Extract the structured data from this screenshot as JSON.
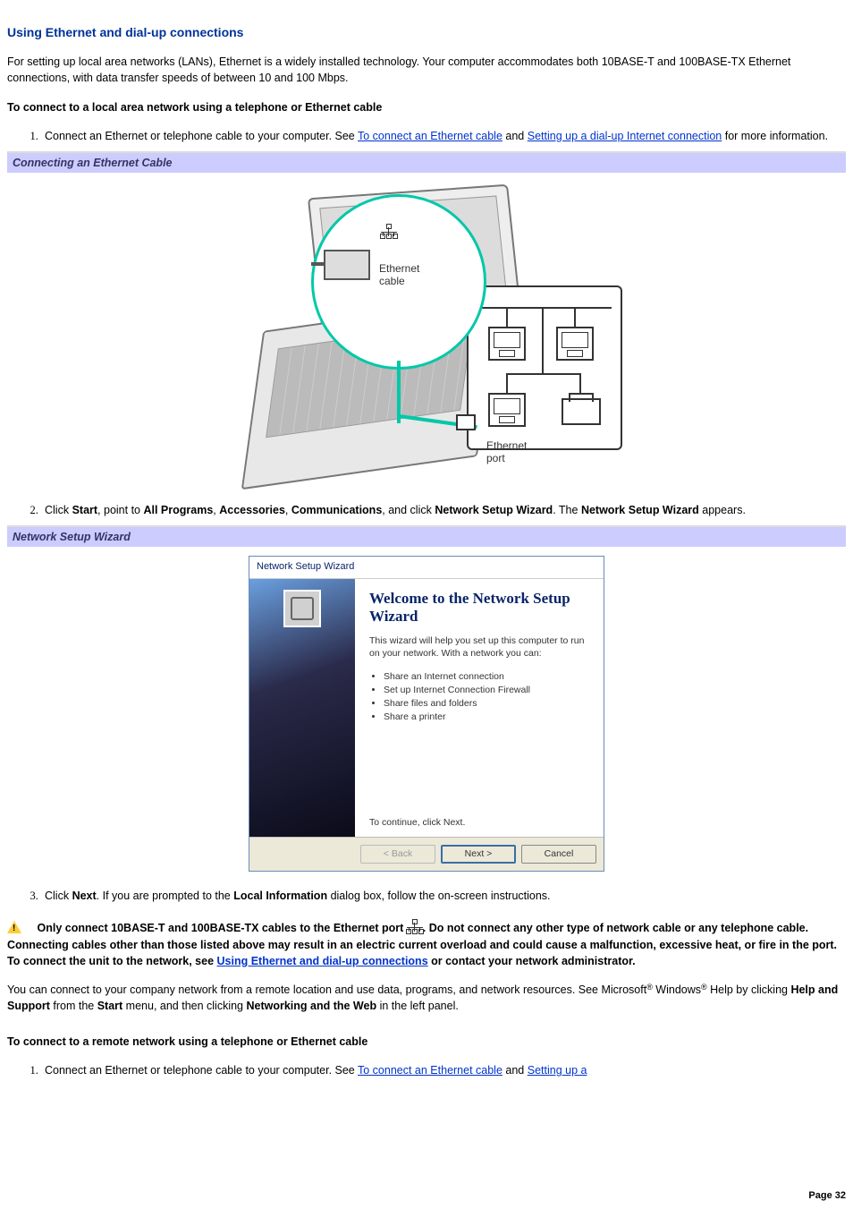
{
  "title": "Using Ethernet and dial-up connections",
  "intro": "For setting up local area networks (LANs), Ethernet is a widely installed technology. Your computer accommodates both 10BASE-T and 100BASE-TX Ethernet connections, with data transfer speeds of between 10 and 100 Mbps.",
  "proc1_heading": "To connect to a local area network using a telephone or Ethernet cable",
  "proc1": {
    "step1_pre": "Connect an Ethernet or telephone cable to your computer. See ",
    "step1_link1": "To connect an Ethernet cable",
    "step1_mid": " and ",
    "step1_link2": "Setting up a dial-up Internet connection",
    "step1_post": " for more information.",
    "band1": "Connecting an Ethernet Cable",
    "ether_label_cable": "Ethernet\ncable",
    "ether_label_port": "Ethernet\nport",
    "step2_pre": "Click ",
    "step2_b1": "Start",
    "step2_t1": ", point to ",
    "step2_b2": "All Programs",
    "step2_t2": ", ",
    "step2_b3": "Accessories",
    "step2_t3": ", ",
    "step2_b4": "Communications",
    "step2_t4": ", and click ",
    "step2_b5": "Network Setup Wizard",
    "step2_t5": ". The ",
    "step2_b6": "Network Setup Wizard",
    "step2_t6": " appears.",
    "band2": "Network Setup Wizard",
    "step3_pre": "Click ",
    "step3_b1": "Next",
    "step3_t1": ". If you are prompted to the ",
    "step3_b2": "Local Information",
    "step3_t2": " dialog box, follow the on-screen instructions."
  },
  "wizard": {
    "title": "Network Setup Wizard",
    "heading": "Welcome to the Network Setup Wizard",
    "desc": "This wizard will help you set up this computer to run on your network. With a network you can:",
    "bullets": [
      "Share an Internet connection",
      "Set up Internet Connection Firewall",
      "Share files and folders",
      "Share a printer"
    ],
    "continue": "To continue, click Next.",
    "btn_back": "< Back",
    "btn_next": "Next >",
    "btn_cancel": "Cancel"
  },
  "warning": {
    "pre": "Only connect 10BASE-T and 100BASE-TX cables to the Ethernet port ",
    "mid1": ". Do not connect any other type of network cable or any telephone cable. Connecting cables other than those listed above may result in an electric current overload and could cause a malfunction, excessive heat, or fire in the port. To connect the unit to the network, see ",
    "link": "Using Ethernet and dial-up connections",
    "post": " or contact your network administrator."
  },
  "remote_para": {
    "t1": "You can connect to your company network from a remote location and use data, programs, and network resources. See Microsoft",
    "reg1": "®",
    "t2": " Windows",
    "reg2": "®",
    "t3": " Help by clicking ",
    "b1": "Help and Support",
    "t4": " from the ",
    "b2": "Start",
    "t5": " menu, and then clicking ",
    "b3": "Networking and the Web",
    "t6": " in the left panel."
  },
  "proc2_heading": "To connect to a remote network using a telephone or Ethernet cable",
  "proc2": {
    "step1_pre": "Connect an Ethernet or telephone cable to your computer. See ",
    "step1_link1": "To connect an Ethernet cable",
    "step1_mid": " and ",
    "step1_link2": "Setting up a"
  },
  "page_number": "Page 32"
}
